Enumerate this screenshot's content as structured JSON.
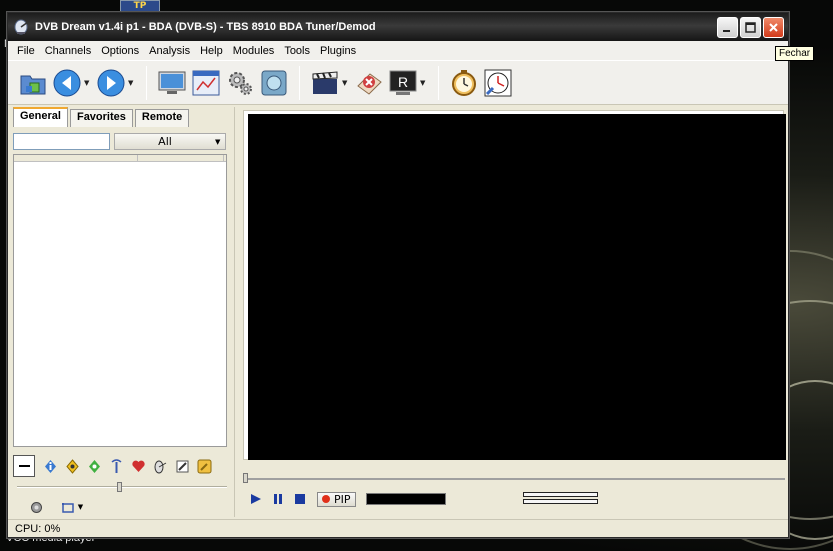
{
  "desktop": {
    "icon_text": "TP",
    "label_left": "M",
    "label_bottom": "VCC media player"
  },
  "tooltip": "Fechar",
  "window": {
    "title": "DVB Dream v1.4i p1 - BDA (DVB-S)  -  TBS 8910 BDA Tuner/Demod",
    "caption_buttons": [
      "minimize-icon",
      "maximize-icon",
      "close-icon"
    ]
  },
  "menu": [
    "File",
    "Channels",
    "Options",
    "Analysis",
    "Help",
    "Modules",
    "Tools",
    "Plugins"
  ],
  "toolbar": {
    "buttons": [
      "open-folder-icon",
      "back-icon",
      "forward-icon",
      "monitor-icon",
      "epg-icon",
      "settings-gear-icon",
      "screenshot-icon",
      "clapperboard-icon",
      "stop-record-icon",
      "record-icon",
      "timer-icon",
      "scheduler-clock-icon"
    ]
  },
  "left_panel": {
    "tabs": [
      "General",
      "Favorites",
      "Remote"
    ],
    "active_tab": "General",
    "filter_value": "",
    "filter_select": "All",
    "icon_row": [
      "minus-icon",
      "info-icon",
      "radiation-icon",
      "diamond-icon",
      "antenna-icon",
      "heart-icon",
      "satellite-dish-icon",
      "edit-icon",
      "key-icon"
    ],
    "slider_value": 0.5,
    "bottom_icons": [
      "volume-icon",
      "layout-icon"
    ]
  },
  "player": {
    "pip_label": "PIP",
    "seek_position": 0,
    "signal_level": 0,
    "colors": {
      "video_bg": "#000000",
      "record_dot": "#e0301a"
    }
  },
  "status": {
    "cpu": "CPU: 0%"
  }
}
